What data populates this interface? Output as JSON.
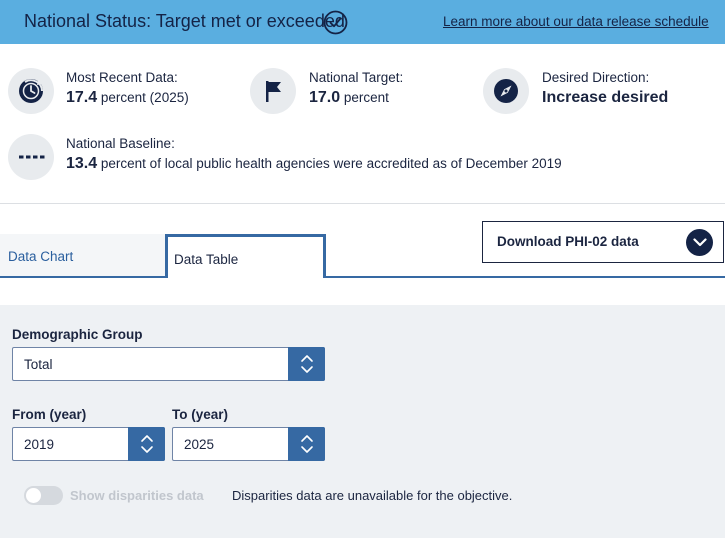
{
  "status": {
    "text": "National Status: Target met or exceeded",
    "link": "Learn more about our data release schedule",
    "color": "#5aaee0"
  },
  "stats": {
    "recent": {
      "label": "Most Recent Data:",
      "value": "17.4",
      "unit": "percent (2025)",
      "icon": "clock-refresh-icon"
    },
    "target": {
      "label": "National Target:",
      "value": "17.0",
      "unit": "percent",
      "icon": "flag-icon"
    },
    "direction": {
      "label": "Desired Direction:",
      "value": "Increase desired",
      "icon": "compass-icon"
    },
    "baseline": {
      "label": "National Baseline:",
      "value": "13.4",
      "unit": "percent of local public health agencies were accredited as of December 2019",
      "icon": "dashed-line-icon"
    }
  },
  "tabs": {
    "chart": "Data Chart",
    "table": "Data Table",
    "active": "Data Table"
  },
  "download": {
    "label": "Download PHI-02 data"
  },
  "filters": {
    "demographic": {
      "label": "Demographic Group",
      "value": "Total"
    },
    "from": {
      "label": "From (year)",
      "value": "2019"
    },
    "to": {
      "label": "To (year)",
      "value": "2025"
    }
  },
  "disparities": {
    "toggle_label": "Show disparities data",
    "enabled": false,
    "note": "Disparities data are unavailable for the objective."
  },
  "colors": {
    "navy": "#142346",
    "accent": "#3669a3",
    "panel": "#eef1f4"
  }
}
